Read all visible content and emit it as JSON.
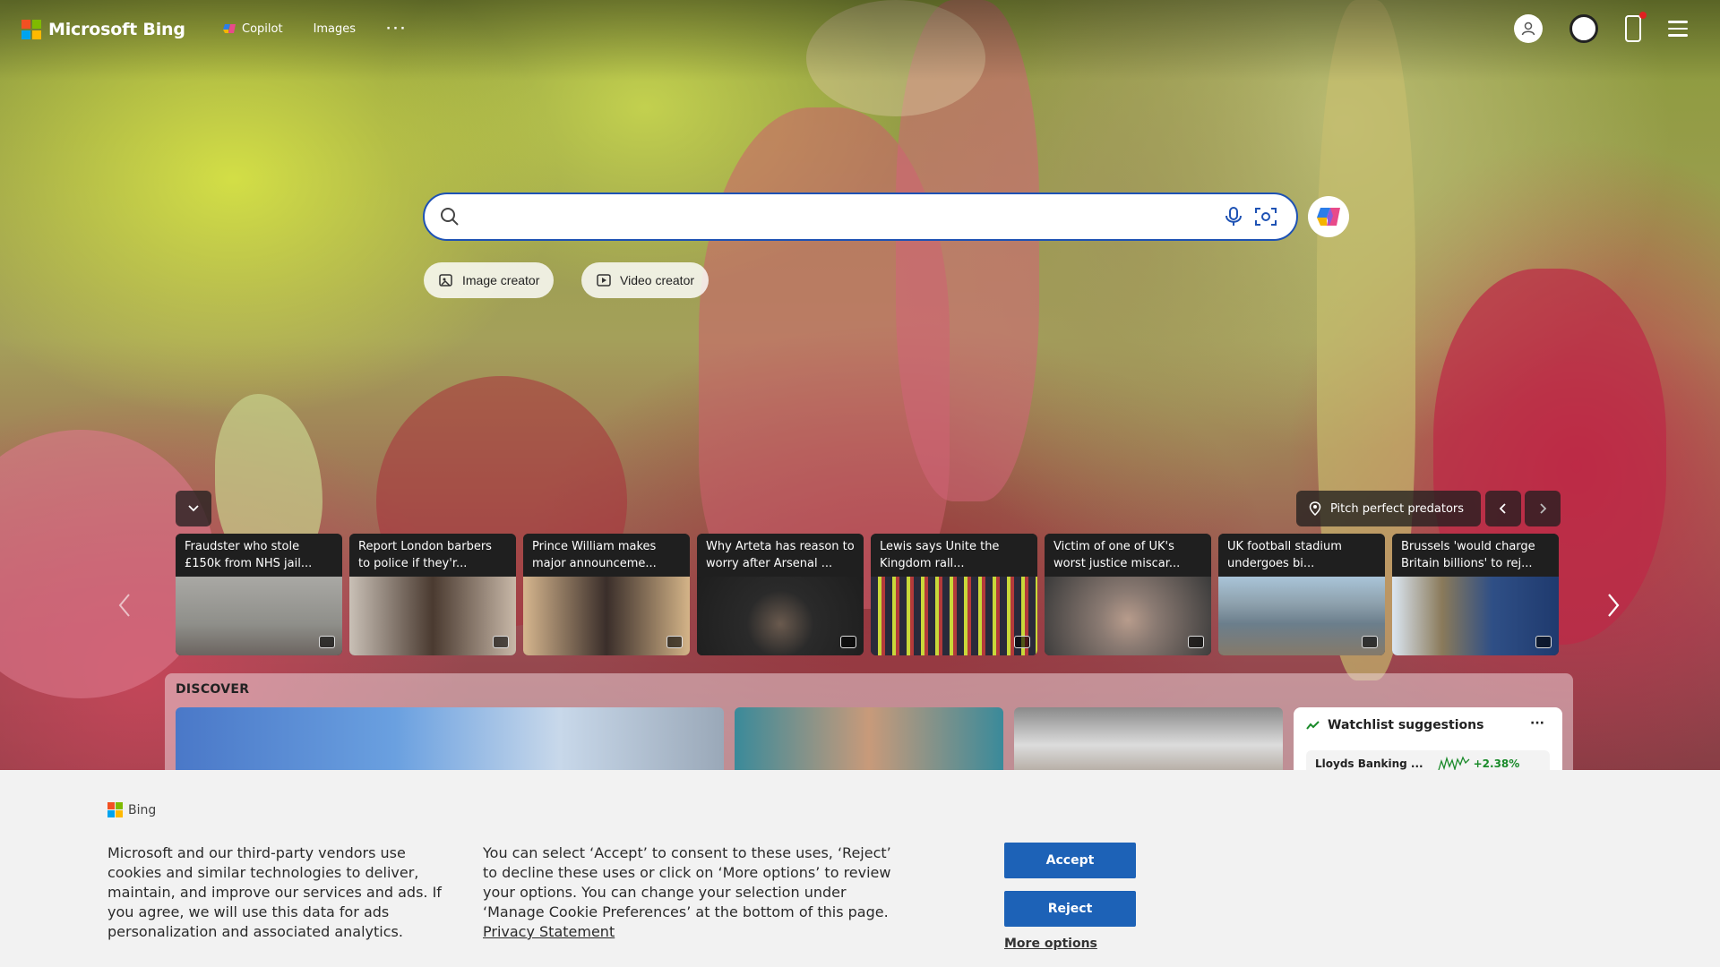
{
  "header": {
    "brand": "Microsoft Bing",
    "nav": [
      {
        "label": "Copilot",
        "icon": "copilot-icon"
      },
      {
        "label": "Images"
      }
    ],
    "more": "···"
  },
  "search": {
    "value": "",
    "placeholder": ""
  },
  "creators": {
    "image_creator": "Image creator",
    "video_creator": "Video creator"
  },
  "carousel": {
    "location_label": "Pitch perfect predators",
    "cards": [
      {
        "caption": "Fraudster who stole £150k from NHS jail...",
        "color": "#8f8f8a"
      },
      {
        "caption": "Report London barbers to police if they'r...",
        "color": "#7a6a5c"
      },
      {
        "caption": "Prince William makes major announceme...",
        "color": "#9a7a60"
      },
      {
        "caption": "Why Arteta has reason to worry after Arsenal ...",
        "color": "#2d2d2d"
      },
      {
        "caption": "Lewis says Unite the Kingdom rall...",
        "color": "#4b5a3a"
      },
      {
        "caption": "Victim of one of UK's worst justice miscar...",
        "color": "#8a7a72"
      },
      {
        "caption": "UK football stadium undergoes bi...",
        "color": "#6b7e8c"
      },
      {
        "caption": "Brussels 'would charge Britain billions' to rej...",
        "color": "#2f4f86"
      }
    ]
  },
  "discover": {
    "title": "DISCOVER",
    "watchlist": {
      "title": "Watchlist suggestions",
      "more": "···",
      "stock_name": "Lloyds Banking ...",
      "stock_change": "+2.38%"
    }
  },
  "cookie": {
    "brand": "Bing",
    "text1": "Microsoft and our third-party vendors use cookies and similar technologies to deliver, maintain, and improve our services and ads. If you agree, we will use this data for ads personalization and associated analytics.",
    "text2": "You can select ‘Accept’ to consent to these uses, ‘Reject’ to decline these uses or click on ‘More options’ to review your options. You can change your selection under ‘Manage Cookie Preferences’ at the bottom of this page.",
    "privacy_link": "Privacy Statement",
    "accept": "Accept",
    "reject": "Reject",
    "more_options": "More options"
  },
  "colors": {
    "ms_red": "#f25022",
    "ms_green": "#7fba00",
    "ms_blue": "#00a4ef",
    "ms_yellow": "#ffb900",
    "accent_blue": "#1d62b7",
    "stock_green": "#1a8a2a"
  }
}
